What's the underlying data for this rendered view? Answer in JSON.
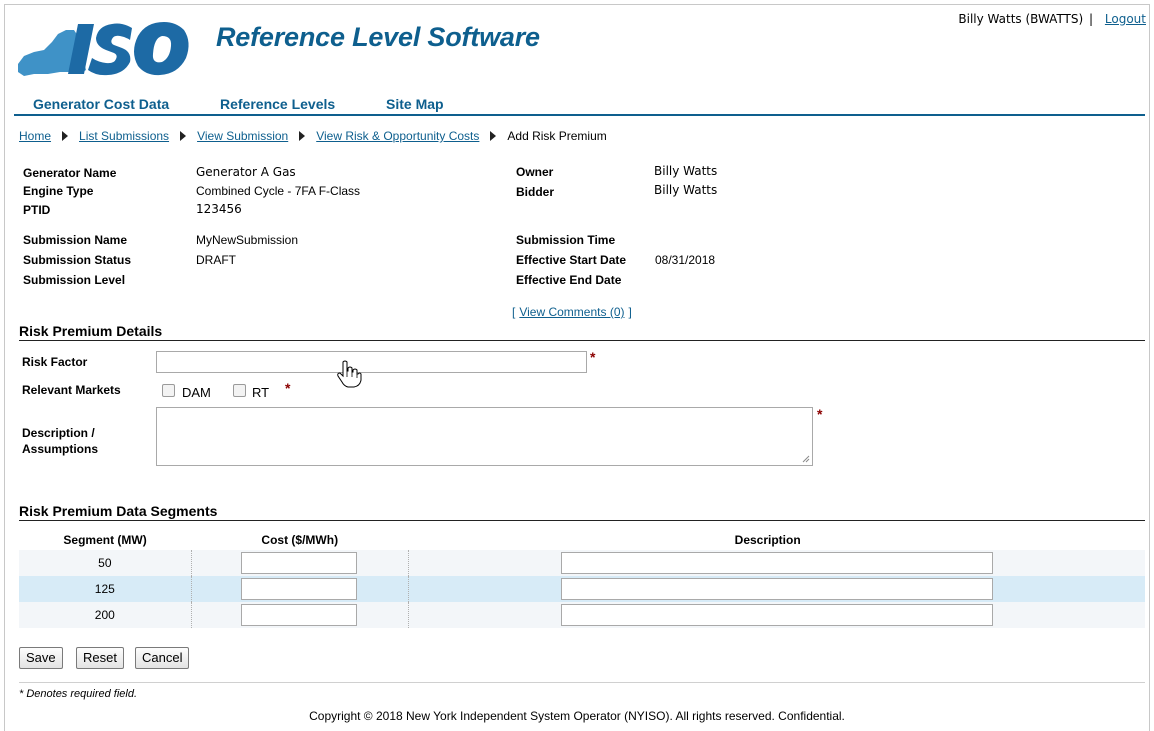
{
  "header": {
    "logo_text": "ISO",
    "app_title": "Reference Level Software",
    "user": "Billy Watts (BWATTS)",
    "separator": "|",
    "logout": "Logout",
    "brand_color": "#0e5f8e"
  },
  "nav": {
    "items": [
      "Generator Cost Data",
      "Reference Levels",
      "Site Map"
    ]
  },
  "breadcrumb": {
    "items": [
      "Home",
      "List Submissions",
      "View Submission",
      "View Risk & Opportunity Costs"
    ],
    "current": "Add Risk Premium"
  },
  "generator": {
    "name_label": "Generator Name",
    "name_value": "Generator A Gas",
    "engine_label": "Engine Type",
    "engine_value": "Combined Cycle - 7FA F-Class",
    "ptid_label": "PTID",
    "ptid_value": "123456",
    "owner_label": "Owner",
    "owner_value": "Billy Watts",
    "bidder_label": "Bidder",
    "bidder_value": "Billy Watts"
  },
  "submission": {
    "name_label": "Submission Name",
    "name_value": "MyNewSubmission",
    "status_label": "Submission Status",
    "status_value": "DRAFT",
    "level_label": "Submission Level",
    "level_value": "",
    "time_label": "Submission Time",
    "time_value": "",
    "start_label": "Effective Start Date",
    "start_value": "08/31/2018",
    "end_label": "Effective End Date",
    "end_value": ""
  },
  "comments": {
    "open": "[",
    "link": "View Comments (0)",
    "close": "]"
  },
  "details": {
    "title": "Risk Premium Details",
    "risk_factor_label": "Risk Factor",
    "risk_factor_value": "",
    "markets_label": "Relevant Markets",
    "markets": [
      "DAM",
      "RT"
    ],
    "description_label_1": "Description /",
    "description_label_2": "Assumptions",
    "description_value": "",
    "required_mark": "*"
  },
  "segments": {
    "title": "Risk Premium Data Segments",
    "headers": [
      "Segment (MW)",
      "Cost ($/MWh)",
      "Description"
    ],
    "rows": [
      {
        "segment": "50",
        "cost": "",
        "description": ""
      },
      {
        "segment": "125",
        "cost": "",
        "description": ""
      },
      {
        "segment": "200",
        "cost": "",
        "description": ""
      }
    ],
    "highlight_color": "#d7ebf7"
  },
  "buttons": {
    "save": "Save",
    "reset": "Reset",
    "cancel": "Cancel"
  },
  "footer": {
    "required_note": "* Denotes required field.",
    "copyright": "Copyright © 2018 New York Independent System Operator (NYISO). All rights reserved. Confidential."
  }
}
